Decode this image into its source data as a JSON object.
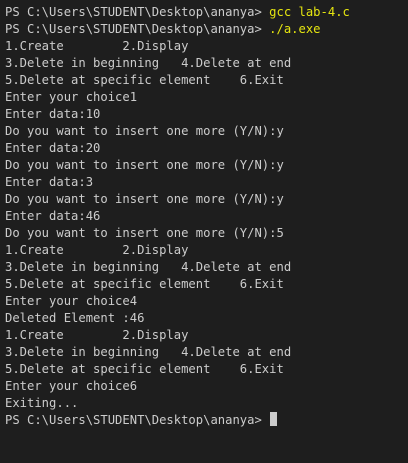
{
  "terminal": {
    "lines": [
      {
        "prompt": "PS C:\\Users\\STUDENT\\Desktop\\ananya> ",
        "command": "gcc lab-4.c"
      },
      {
        "prompt": "PS C:\\Users\\STUDENT\\Desktop\\ananya> ",
        "command": "./a.exe"
      },
      {
        "text": "1.Create        2.Display"
      },
      {
        "text": "3.Delete in beginning   4.Delete at end"
      },
      {
        "text": "5.Delete at specific element    6.Exit"
      },
      {
        "text": "Enter your choice1"
      },
      {
        "text": "Enter data:10"
      },
      {
        "text": "Do you want to insert one more (Y/N):y"
      },
      {
        "text": "Enter data:20"
      },
      {
        "text": "Do you want to insert one more (Y/N):y"
      },
      {
        "text": "Enter data:3"
      },
      {
        "text": "Do you want to insert one more (Y/N):y"
      },
      {
        "text": "Enter data:46"
      },
      {
        "text": "Do you want to insert one more (Y/N):5"
      },
      {
        "text": "1.Create        2.Display"
      },
      {
        "text": "3.Delete in beginning   4.Delete at end"
      },
      {
        "text": "5.Delete at specific element    6.Exit"
      },
      {
        "text": "Enter your choice4"
      },
      {
        "text": "Deleted Element :46"
      },
      {
        "text": "1.Create        2.Display"
      },
      {
        "text": "3.Delete in beginning   4.Delete at end"
      },
      {
        "text": "5.Delete at specific element    6.Exit"
      },
      {
        "text": "Enter your choice6"
      },
      {
        "text": "Exiting..."
      },
      {
        "prompt": "PS C:\\Users\\STUDENT\\Desktop\\ananya> ",
        "cursor": true
      }
    ],
    "colors": {
      "background": "#1e1e1e",
      "text": "#cccccc",
      "command": "#e5e510"
    }
  }
}
